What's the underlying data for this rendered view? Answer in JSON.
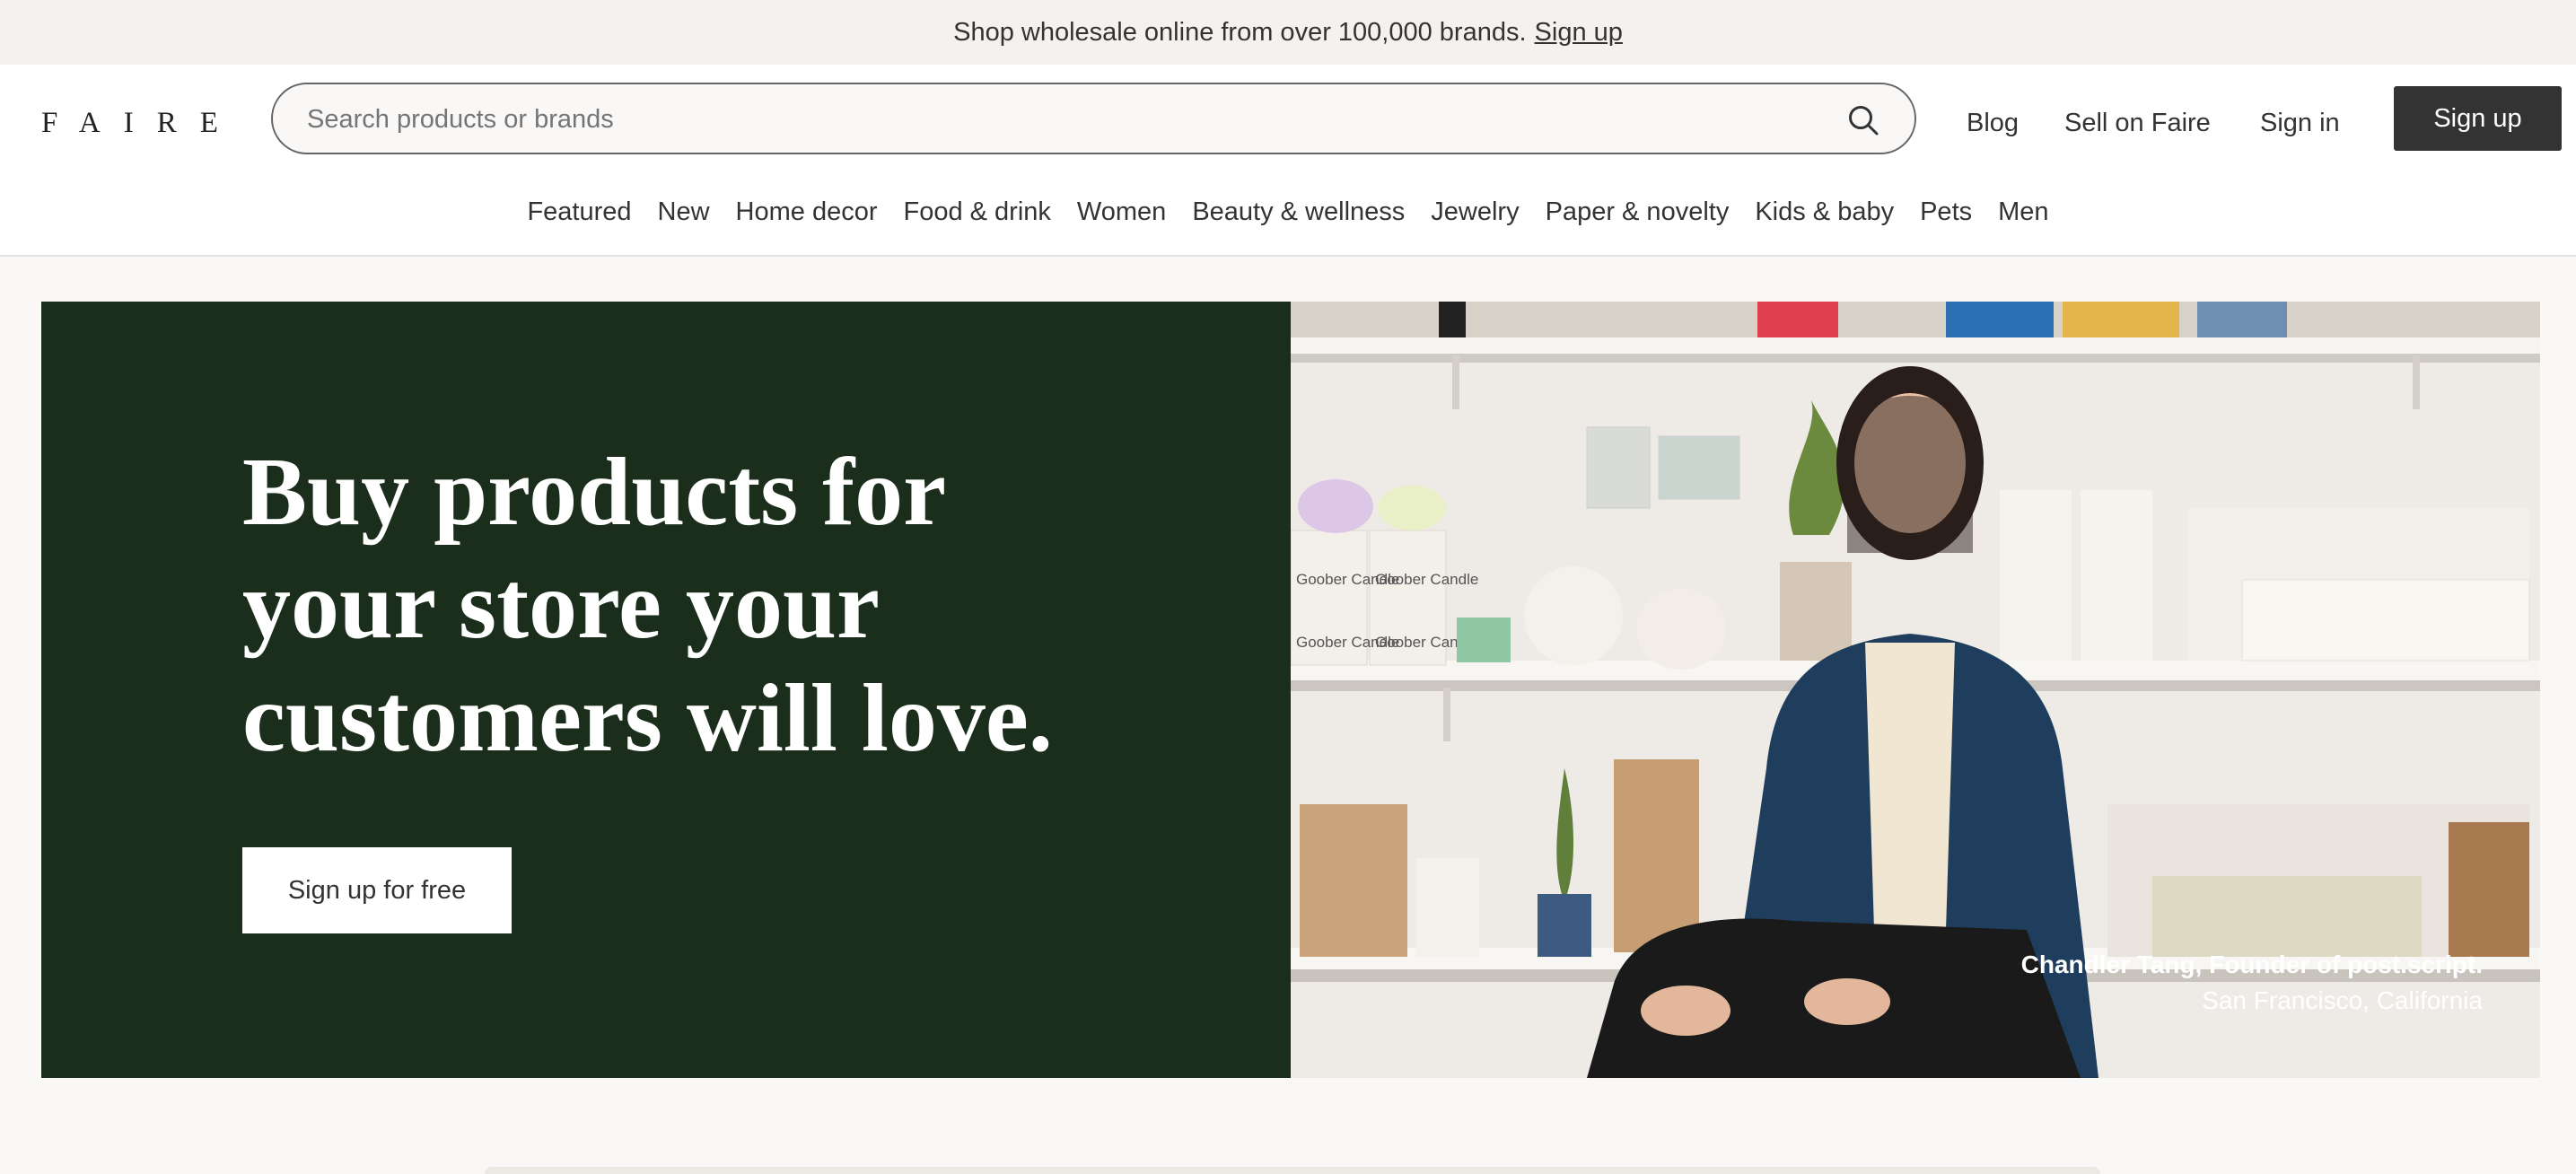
{
  "promo": {
    "text": "Shop wholesale online from over 100,000 brands.",
    "link": "Sign up"
  },
  "header": {
    "logo": "FAIRE",
    "search_placeholder": "Search products or brands",
    "links": {
      "blog": "Blog",
      "sell": "Sell on Faire",
      "signin": "Sign in"
    },
    "signup": "Sign up"
  },
  "categories": [
    "Featured",
    "New",
    "Home decor",
    "Food & drink",
    "Women",
    "Beauty & wellness",
    "Jewelry",
    "Paper & novelty",
    "Kids & baby",
    "Pets",
    "Men"
  ],
  "hero": {
    "headline_lines": [
      "Buy products for",
      "your store your",
      "customers will love."
    ],
    "cta": "Sign up for free",
    "caption_name": "Chandler Tang, Founder of post.script.",
    "caption_location": "San Francisco, California",
    "product_labels": [
      "Goober Candle",
      "Goober Candle",
      "Goober Candle",
      "Goober Candle"
    ]
  },
  "colors": {
    "hero_bg": "#1a2e1b",
    "signup_bg": "#333333",
    "page_bg": "#faf8f6"
  }
}
